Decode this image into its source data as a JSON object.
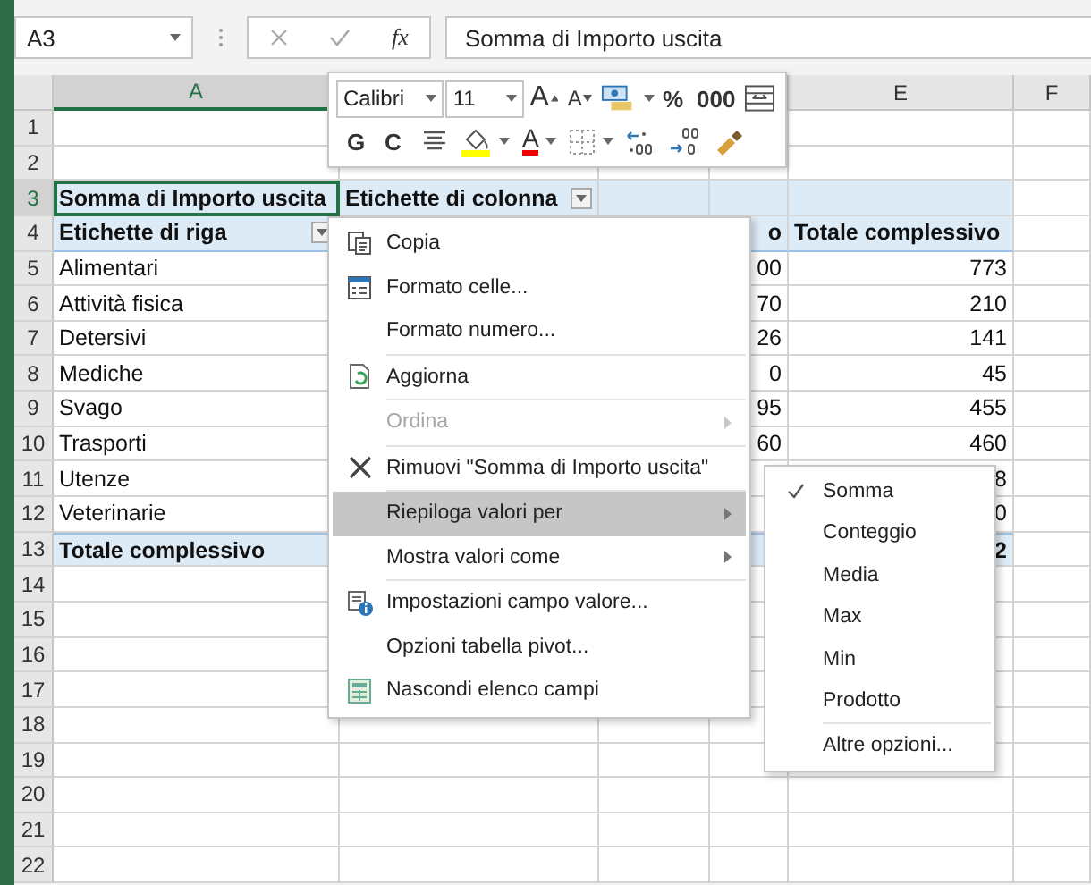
{
  "name_box": {
    "value": "A3"
  },
  "formula_bar": {
    "function_label": "fx",
    "value": "Somma di Importo uscita"
  },
  "columns": [
    {
      "header": "A",
      "selected": true
    },
    {
      "header": "E",
      "selected": false
    },
    {
      "header": "F",
      "selected": false
    }
  ],
  "row_numbers": [
    {
      "label": "1",
      "selected": false
    },
    {
      "label": "2",
      "selected": false
    },
    {
      "label": "3",
      "selected": true
    },
    {
      "label": "4",
      "selected": false
    },
    {
      "label": "5",
      "selected": false
    },
    {
      "label": "6",
      "selected": false
    },
    {
      "label": "7",
      "selected": false
    },
    {
      "label": "8",
      "selected": false
    },
    {
      "label": "9",
      "selected": false
    },
    {
      "label": "10",
      "selected": false
    },
    {
      "label": "11",
      "selected": false
    },
    {
      "label": "12",
      "selected": false
    },
    {
      "label": "13",
      "selected": false
    },
    {
      "label": "14",
      "selected": false
    },
    {
      "label": "15",
      "selected": false
    },
    {
      "label": "16",
      "selected": false
    },
    {
      "label": "17",
      "selected": false
    },
    {
      "label": "18",
      "selected": false
    },
    {
      "label": "19",
      "selected": false
    },
    {
      "label": "20",
      "selected": false
    },
    {
      "label": "21",
      "selected": false
    },
    {
      "label": "22",
      "selected": false
    }
  ],
  "pivot": {
    "value_field": "Somma di Importo uscita",
    "column_labels": "Etichette di colonna",
    "row_labels": "Etichette di riga",
    "column_4_header": "o",
    "total_header": "Totale complessivo",
    "rows": [
      {
        "label": "Alimentari",
        "column_4": "00",
        "total": "773"
      },
      {
        "label": "Attività fisica",
        "column_4": "70",
        "total": "210"
      },
      {
        "label": "Detersivi",
        "column_4": "26",
        "total": "141"
      },
      {
        "label": "Mediche",
        "column_4": "0",
        "total": "45"
      },
      {
        "label": "Svago",
        "column_4": "95",
        "total": "455"
      },
      {
        "label": "Trasporti",
        "column_4": "60",
        "total": "460"
      },
      {
        "label": "Utenze",
        "total": "8"
      },
      {
        "label": "Veterinarie",
        "total": "0"
      }
    ],
    "grand_total": {
      "label": "Totale complessivo",
      "total": "2"
    }
  },
  "mini_toolbar": {
    "font": "Calibri",
    "size": "11",
    "row_1": [
      {
        "kind": "grow",
        "label": "A"
      },
      {
        "kind": "shrink",
        "label": "A"
      },
      {
        "kind": "accounting",
        "dropdown": true
      },
      {
        "kind": "text",
        "label": "%"
      },
      {
        "kind": "text",
        "label": "000"
      },
      {
        "kind": "wrap"
      }
    ],
    "row_2": [
      {
        "kind": "bold",
        "label": "G"
      },
      {
        "kind": "italic",
        "label": "C"
      },
      {
        "kind": "align"
      },
      {
        "kind": "fill",
        "dropdown": true
      },
      {
        "kind": "fontcolor",
        "label": "A",
        "dropdown": true
      },
      {
        "kind": "borders",
        "dropdown": true
      },
      {
        "kind": "incdec"
      },
      {
        "kind": "decdec"
      },
      {
        "kind": "painter"
      }
    ]
  },
  "context_menu": [
    {
      "label": "Copia",
      "kind": "copy",
      "disabled": false,
      "selected": false
    },
    {
      "label": "Formato celle...",
      "kind": "format",
      "disabled": false,
      "selected": false
    },
    {
      "label": "Formato numero...",
      "disabled": false,
      "selected": false,
      "separator_after": true
    },
    {
      "label": "Aggiorna",
      "kind": "refresh",
      "disabled": false,
      "selected": false,
      "separator_after": true
    },
    {
      "label": "Ordina",
      "disabled": true,
      "selected": false,
      "submenu": true,
      "separator_after": true
    },
    {
      "label": "Rimuovi \"Somma di Importo uscita\"",
      "kind": "remove",
      "disabled": false,
      "selected": false,
      "separator_after": true
    },
    {
      "label": "Riepiloga valori per",
      "disabled": false,
      "selected": true,
      "submenu": true
    },
    {
      "label": "Mostra valori come",
      "disabled": false,
      "selected": false,
      "submenu": true,
      "separator_after": true
    },
    {
      "label": "Impostazioni campo valore...",
      "kind": "settings",
      "disabled": false,
      "selected": false
    },
    {
      "label": "Opzioni tabella pivot...",
      "disabled": false,
      "selected": false
    },
    {
      "label": "Nascondi elenco campi",
      "kind": "fieldlist",
      "disabled": false,
      "selected": false
    }
  ],
  "submenu": [
    {
      "label": "Somma",
      "checked": true
    },
    {
      "label": "Conteggio",
      "checked": false
    },
    {
      "label": "Media",
      "checked": false
    },
    {
      "label": "Max",
      "checked": false
    },
    {
      "label": "Min",
      "checked": false
    },
    {
      "label": "Prodotto",
      "checked": false,
      "separator_after": true
    },
    {
      "label": "Altre opzioni...",
      "checked": false
    }
  ]
}
